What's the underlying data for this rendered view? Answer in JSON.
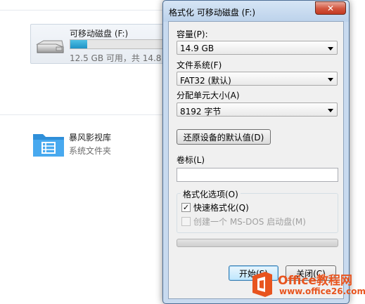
{
  "explorer": {
    "drive": {
      "name": "可移动磁盘 (F:)",
      "usage": "12.5 GB 可用，共 14.8 G",
      "used_fraction": 0.17
    },
    "folder": {
      "name": "暴风影视库",
      "type": "系统文件夹"
    }
  },
  "dialog": {
    "title": "格式化 可移动磁盘 (F:)",
    "close_label": "✕",
    "capacity": {
      "label": "容量(P):",
      "value": "14.9 GB"
    },
    "filesystem": {
      "label": "文件系统(F)",
      "value": "FAT32 (默认)"
    },
    "alloc": {
      "label": "分配单元大小(A)",
      "value": "8192 字节"
    },
    "restore_label": "还原设备的默认值(D)",
    "volume": {
      "label": "卷标(L)",
      "value": ""
    },
    "options": {
      "title": "格式化选项(O)",
      "quick": {
        "label": "快速格式化(Q)",
        "checked": true
      },
      "msdos": {
        "label": "创建一个 MS-DOS 启动盘(M)",
        "checked": false
      }
    },
    "progress_fraction": 0,
    "start_label": "开始(S)",
    "cancel_label": "关闭(C)"
  },
  "watermark": {
    "name": "Office教程网",
    "url": "www.office26.com"
  }
}
